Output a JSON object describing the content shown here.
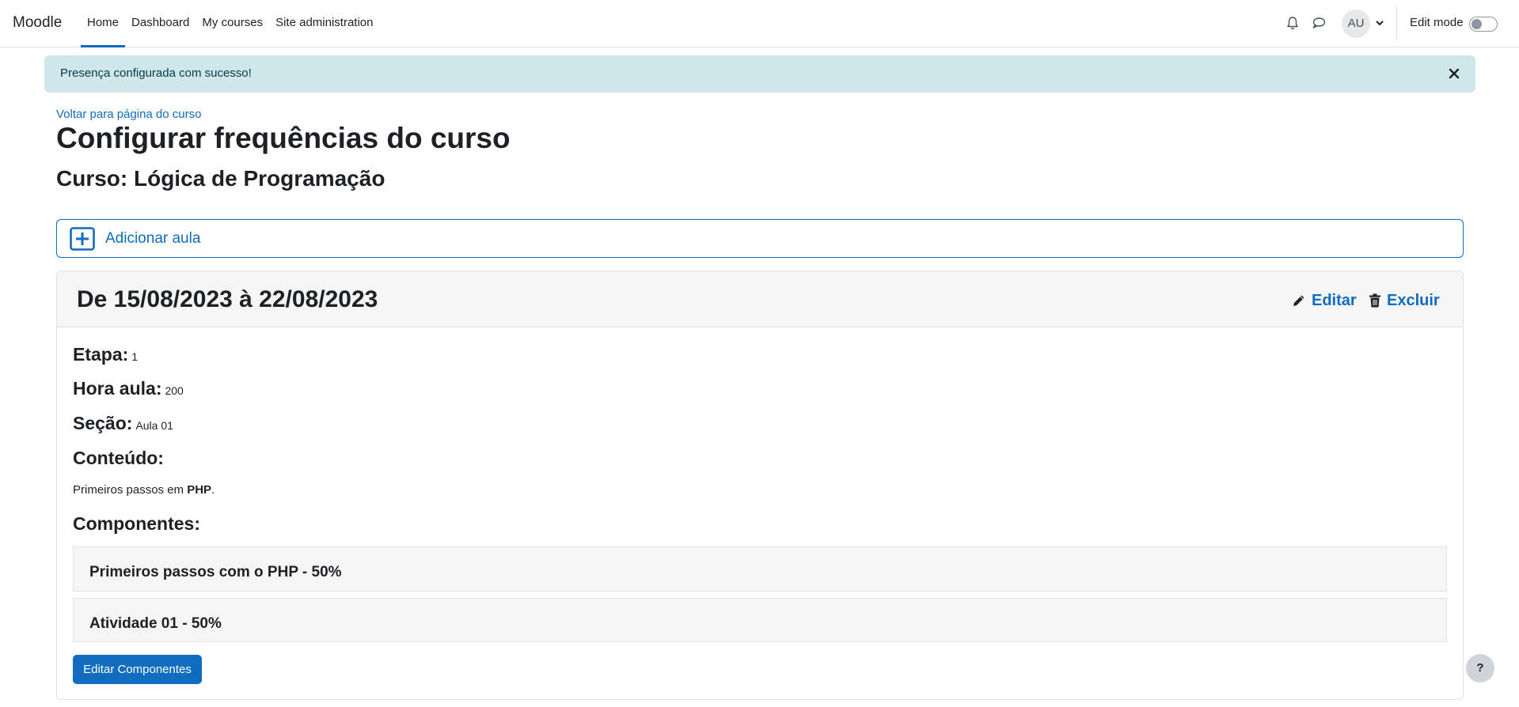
{
  "navbar": {
    "brand": "Moodle",
    "links": [
      "Home",
      "Dashboard",
      "My courses",
      "Site administration"
    ],
    "active_index": 0,
    "avatar_initials": "AU",
    "edit_mode_label": "Edit mode",
    "edit_mode_on": false
  },
  "alert": {
    "message": "Presença configurada com sucesso!"
  },
  "page": {
    "back_link": "Voltar para página do curso",
    "title": "Configurar frequências do curso",
    "course_title": "Curso: Lógica de Programação",
    "add_label": "Adicionar aula"
  },
  "card": {
    "title": "De 15/08/2023 à 22/08/2023",
    "edit_label": "Editar",
    "delete_label": "Excluir",
    "fields": [
      {
        "label": "Etapa:",
        "value": "1"
      },
      {
        "label": "Hora aula:",
        "value": "200"
      },
      {
        "label": "Seção:",
        "value": "Aula 01"
      },
      {
        "label": "Conteúdo:",
        "value": ""
      }
    ],
    "content_prefix": "Primeiros passos em ",
    "content_bold": "PHP",
    "content_suffix": ".",
    "components_label": "Componentes:",
    "components": [
      "Primeiros passos com o PHP - 50%",
      "Atividade 01 - 50%"
    ],
    "edit_components_label": "Editar Componentes"
  },
  "help": "?",
  "colors": {
    "primary": "#0f6cbf",
    "alert_bg": "#cfe6ea",
    "card_header_bg": "#f5f5f5"
  }
}
